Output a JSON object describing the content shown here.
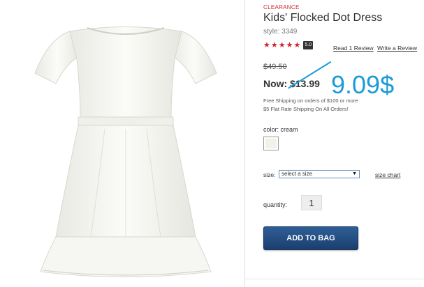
{
  "product": {
    "badge": "CLEARANCE",
    "title": "Kids' Flocked Dot Dress",
    "style": "style: 3349",
    "rating": {
      "stars": 5,
      "score": "5.0",
      "review_link": "Read 1 Review",
      "write_link": "Write a Review"
    },
    "price": {
      "original": "$49.50",
      "now": "Now: $13.99",
      "handwritten_price": "9.09$"
    },
    "shipping": [
      "Free Shipping on orders of $100 or more",
      "$5 Flat Rate Shipping On All Orders!"
    ],
    "color": {
      "label": "color: cream",
      "swatch": "#f4f1ea"
    },
    "size": {
      "label": "size:",
      "selected": "select a size",
      "chart_link": "size chart"
    },
    "quantity": {
      "label": "quantity:",
      "value": "1"
    },
    "add_button": "ADD TO BAG"
  },
  "colors": {
    "accent_red": "#d2232a",
    "annotation_blue": "#1a9bd8",
    "button_blue": "#1b3f6e"
  }
}
